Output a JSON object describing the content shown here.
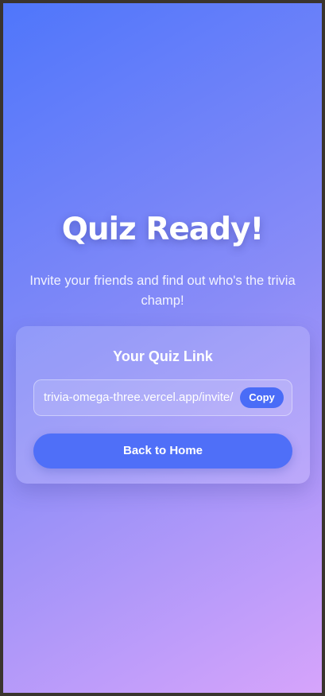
{
  "hero": {
    "title": "Quiz Ready!",
    "subtitle": "Invite your friends and find out who's the trivia champ!"
  },
  "card": {
    "title": "Your Quiz Link",
    "link_value": "trivia-omega-three.vercel.app/invite/",
    "copy_label": "Copy",
    "home_label": "Back to Home"
  },
  "colors": {
    "gradient_start": "#4f76fb",
    "gradient_end": "#d6a4fb",
    "button_primary": "#4a6cf7"
  }
}
